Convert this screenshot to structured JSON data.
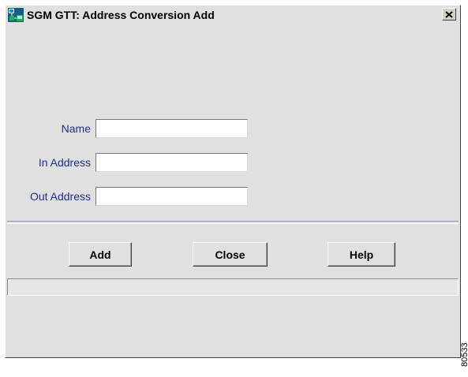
{
  "window": {
    "title": "SGM GTT:  Address Conversion Add",
    "close_glyph": "✕"
  },
  "fields": [
    {
      "label": "Name",
      "value": "",
      "placeholder": ""
    },
    {
      "label": "In Address",
      "value": "",
      "placeholder": ""
    },
    {
      "label": "Out Address",
      "value": "",
      "placeholder": ""
    }
  ],
  "buttons": {
    "add": "Add",
    "close": "Close",
    "help": "Help"
  },
  "status": {
    "text": ""
  },
  "figure_number": "80533",
  "colors": {
    "window_bg": "#e0e0e0",
    "label_text": "#1e2e8c",
    "separator": "#8a8ab8"
  }
}
